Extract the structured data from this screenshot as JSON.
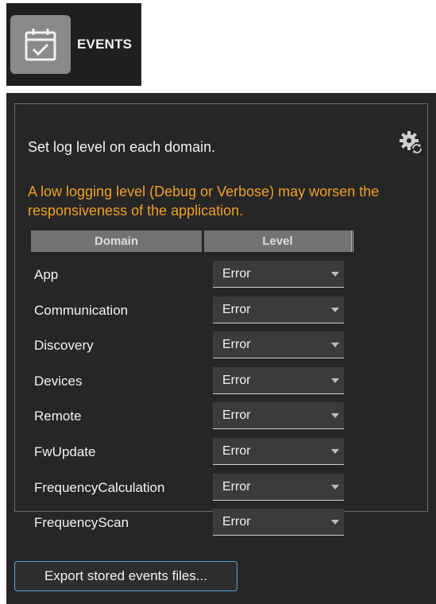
{
  "header": {
    "tab_label": "EVENTS",
    "icon": "calendar-check-icon"
  },
  "log_settings": {
    "description": "Set log level on each domain.",
    "settings_icon": "gear-refresh-icon",
    "warning": "A low logging level (Debug or Verbose) may worsen the responsiveness of the application.",
    "warning_color": "#f0a026",
    "columns": [
      "Domain",
      "Level"
    ],
    "rows": [
      {
        "domain": "App",
        "level": "Error"
      },
      {
        "domain": "Communication",
        "level": "Error"
      },
      {
        "domain": "Discovery",
        "level": "Error"
      },
      {
        "domain": "Devices",
        "level": "Error"
      },
      {
        "domain": "Remote",
        "level": "Error"
      },
      {
        "domain": "FwUpdate",
        "level": "Error"
      },
      {
        "domain": "FrequencyCalculation",
        "level": "Error"
      },
      {
        "domain": "FrequencyScan",
        "level": "Error"
      }
    ]
  },
  "export": {
    "button_label": "Export stored events files..."
  },
  "colors": {
    "background": "#262626",
    "accent_border": "#5aa6d6"
  }
}
